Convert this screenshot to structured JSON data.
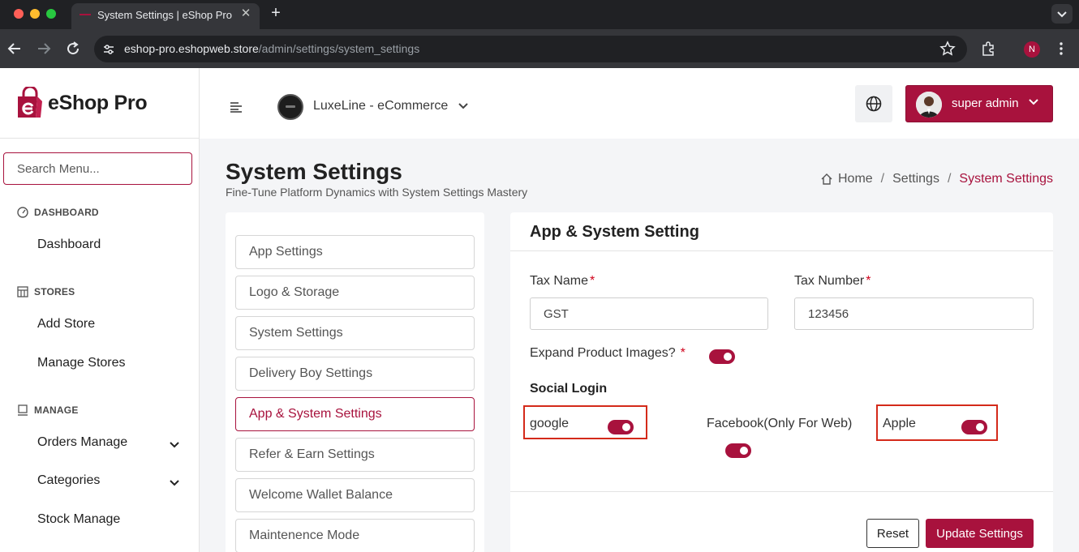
{
  "browser": {
    "tab_title": "System Settings | eShop Pro",
    "url_domain": "eshop-pro.eshopweb.store",
    "url_path": "/admin/settings/system_settings",
    "profile_initial": "N"
  },
  "sidebar": {
    "brand_name": "eShop Pro",
    "search_placeholder": "Search Menu...",
    "sections": [
      {
        "label": "DASHBOARD",
        "icon": "gauge-icon",
        "items": [
          {
            "label": "Dashboard"
          }
        ]
      },
      {
        "label": "STORES",
        "icon": "store-icon",
        "items": [
          {
            "label": "Add Store"
          },
          {
            "label": "Manage Stores"
          }
        ]
      },
      {
        "label": "MANAGE",
        "icon": "monitor-icon",
        "items": [
          {
            "label": "Orders Manage",
            "expandable": true
          },
          {
            "label": "Categories",
            "expandable": true
          },
          {
            "label": "Stock Manage"
          }
        ]
      }
    ]
  },
  "topbar": {
    "store_name": "LuxeLine - eCommerce",
    "user_name": "super admin"
  },
  "page": {
    "title": "System Settings",
    "subtitle": "Fine-Tune Platform Dynamics with System Settings Mastery",
    "breadcrumb": {
      "home": "Home",
      "parent": "Settings",
      "current": "System Settings"
    }
  },
  "settings_menu": [
    {
      "label": "App Settings",
      "active": false
    },
    {
      "label": "Logo & Storage",
      "active": false
    },
    {
      "label": "System Settings",
      "active": false
    },
    {
      "label": "Delivery Boy Settings",
      "active": false
    },
    {
      "label": "App & System Settings",
      "active": true
    },
    {
      "label": "Refer & Earn Settings",
      "active": false
    },
    {
      "label": "Welcome Wallet Balance",
      "active": false
    },
    {
      "label": "Maintenence Mode",
      "active": false
    }
  ],
  "form": {
    "title": "App & System Setting",
    "tax_name_label": "Tax Name",
    "tax_name_value": "GST",
    "tax_number_label": "Tax Number",
    "tax_number_value": "123456",
    "required_mark": "*",
    "expand_images_label": "Expand Product Images?",
    "expand_images_on": true,
    "social_login_title": "Social Login",
    "social": [
      {
        "label": "google",
        "on": true,
        "highlighted": true
      },
      {
        "label": "Facebook(Only For Web)",
        "on": true,
        "highlighted": false
      },
      {
        "label": "Apple",
        "on": true,
        "highlighted": true
      }
    ],
    "reset_label": "Reset",
    "update_label": "Update Settings"
  },
  "colors": {
    "accent": "#a8123d",
    "highlight_border": "#d42a1a"
  }
}
